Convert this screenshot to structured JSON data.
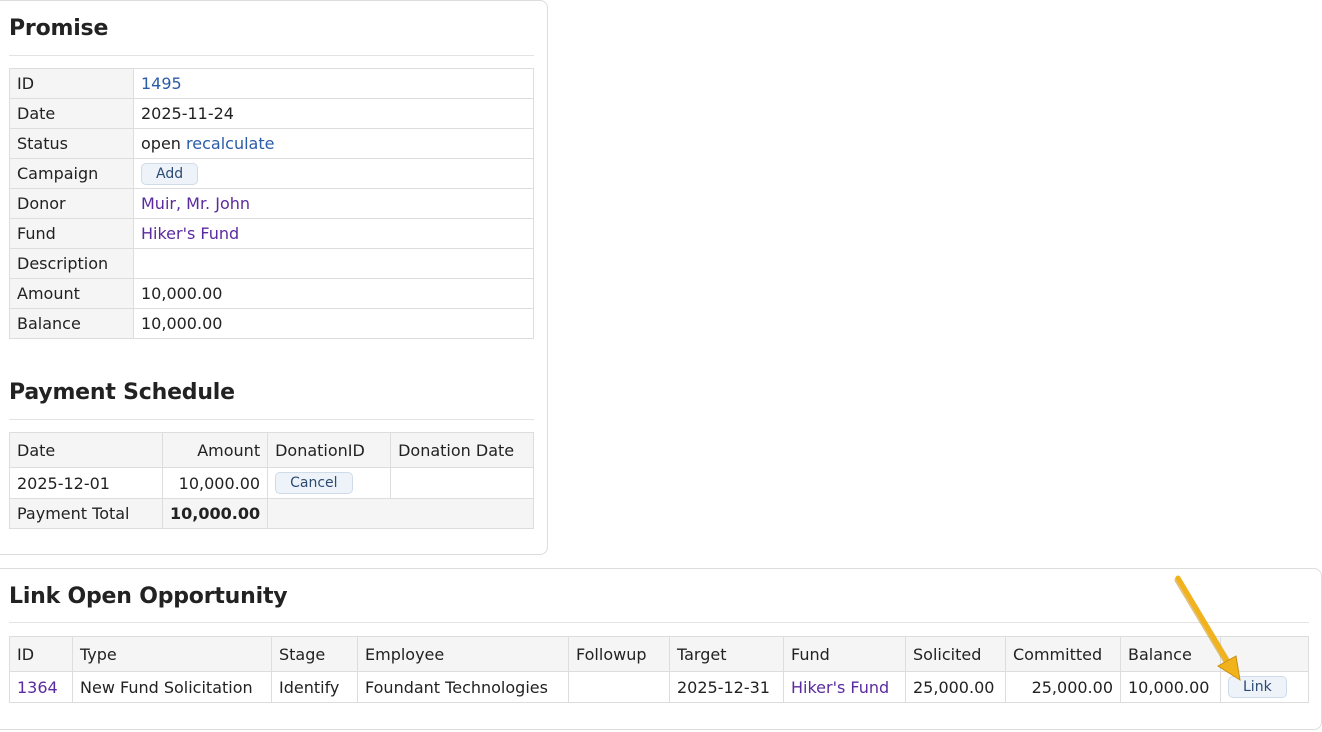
{
  "promise": {
    "title": "Promise",
    "fields": {
      "id_label": "ID",
      "id_value": "1495",
      "date_label": "Date",
      "date_value": "2025-11-24",
      "status_label": "Status",
      "status_value": "open",
      "status_action": "recalculate",
      "campaign_label": "Campaign",
      "campaign_button": "Add",
      "donor_label": "Donor",
      "donor_value": "Muir, Mr. John",
      "fund_label": "Fund",
      "fund_value": "Hiker's Fund",
      "description_label": "Description",
      "description_value": "",
      "amount_label": "Amount",
      "amount_value": "10,000.00",
      "balance_label": "Balance",
      "balance_value": "10,000.00"
    }
  },
  "schedule": {
    "title": "Payment Schedule",
    "headers": [
      "Date",
      "Amount",
      "DonationID",
      "Donation Date"
    ],
    "row": {
      "date": "2025-12-01",
      "amount": "10,000.00",
      "cancel_button": "Cancel",
      "donation_date": ""
    },
    "total_label": "Payment Total",
    "total_value": "10,000.00"
  },
  "opportunity": {
    "title": "Link Open Opportunity",
    "headers": [
      "ID",
      "Type",
      "Stage",
      "Employee",
      "Followup",
      "Target",
      "Fund",
      "Solicited",
      "Committed",
      "Balance",
      ""
    ],
    "row": {
      "id": "1364",
      "type": "New Fund Solicitation",
      "stage": "Identify",
      "employee": "Foundant Technologies",
      "followup": "",
      "target": "2025-12-31",
      "fund": "Hiker's Fund",
      "solicited": "25,000.00",
      "committed": "25,000.00",
      "balance": "10,000.00",
      "link_button": "Link"
    }
  },
  "colors": {
    "link": "#2a5ca8",
    "visited_link": "#5b2a9e",
    "annotation_arrow": "#f2b21b"
  }
}
